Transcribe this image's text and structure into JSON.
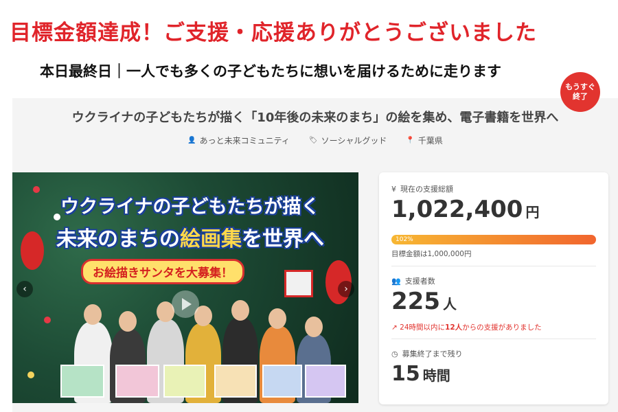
{
  "banner": {
    "headline": "目標金額達成！ご支援・応援ありがとうございました",
    "subline": "本日最終日｜一人でも多くの子どもたちに想いを届けるために走ります"
  },
  "project": {
    "title": "ウクライナの子どもたちが描く「10年後の未来のまち」の絵を集め、電子書籍を世界へ",
    "meta": [
      {
        "icon": "user-icon",
        "text": "あっと未来コミュニティ"
      },
      {
        "icon": "tag-icon",
        "text": "ソーシャルグッド"
      },
      {
        "icon": "location-pin-icon",
        "text": "千葉県"
      }
    ]
  },
  "hero": {
    "line1": "ウクライナの子どもたちが描く",
    "line2_prefix": "未来のまちの",
    "line2_highlight": "絵画集",
    "line2_suffix": "を世界へ",
    "badge": "お絵描きサンタを大募集！",
    "prev": "‹",
    "next": "›"
  },
  "stats": {
    "ending_badge": "もうすぐ\n終了",
    "total_label": "現在の支援総額",
    "total_value": "1,022,400",
    "total_unit": "円",
    "progress_percent": 102,
    "progress_label": "102%",
    "goal_text": "目標金額は1,000,000円",
    "supporters_label": "支援者数",
    "supporters_value": "225",
    "supporters_unit": "人",
    "recent_prefix": "24時間以内に",
    "recent_count": "12人",
    "recent_suffix": "からの支援がありました",
    "remaining_label": "募集終了まで残り",
    "remaining_value": "15",
    "remaining_unit": "時間"
  },
  "colors": {
    "accent_red": "#e0242a",
    "progress_start": "#f7b733",
    "progress_end": "#f1652e"
  }
}
